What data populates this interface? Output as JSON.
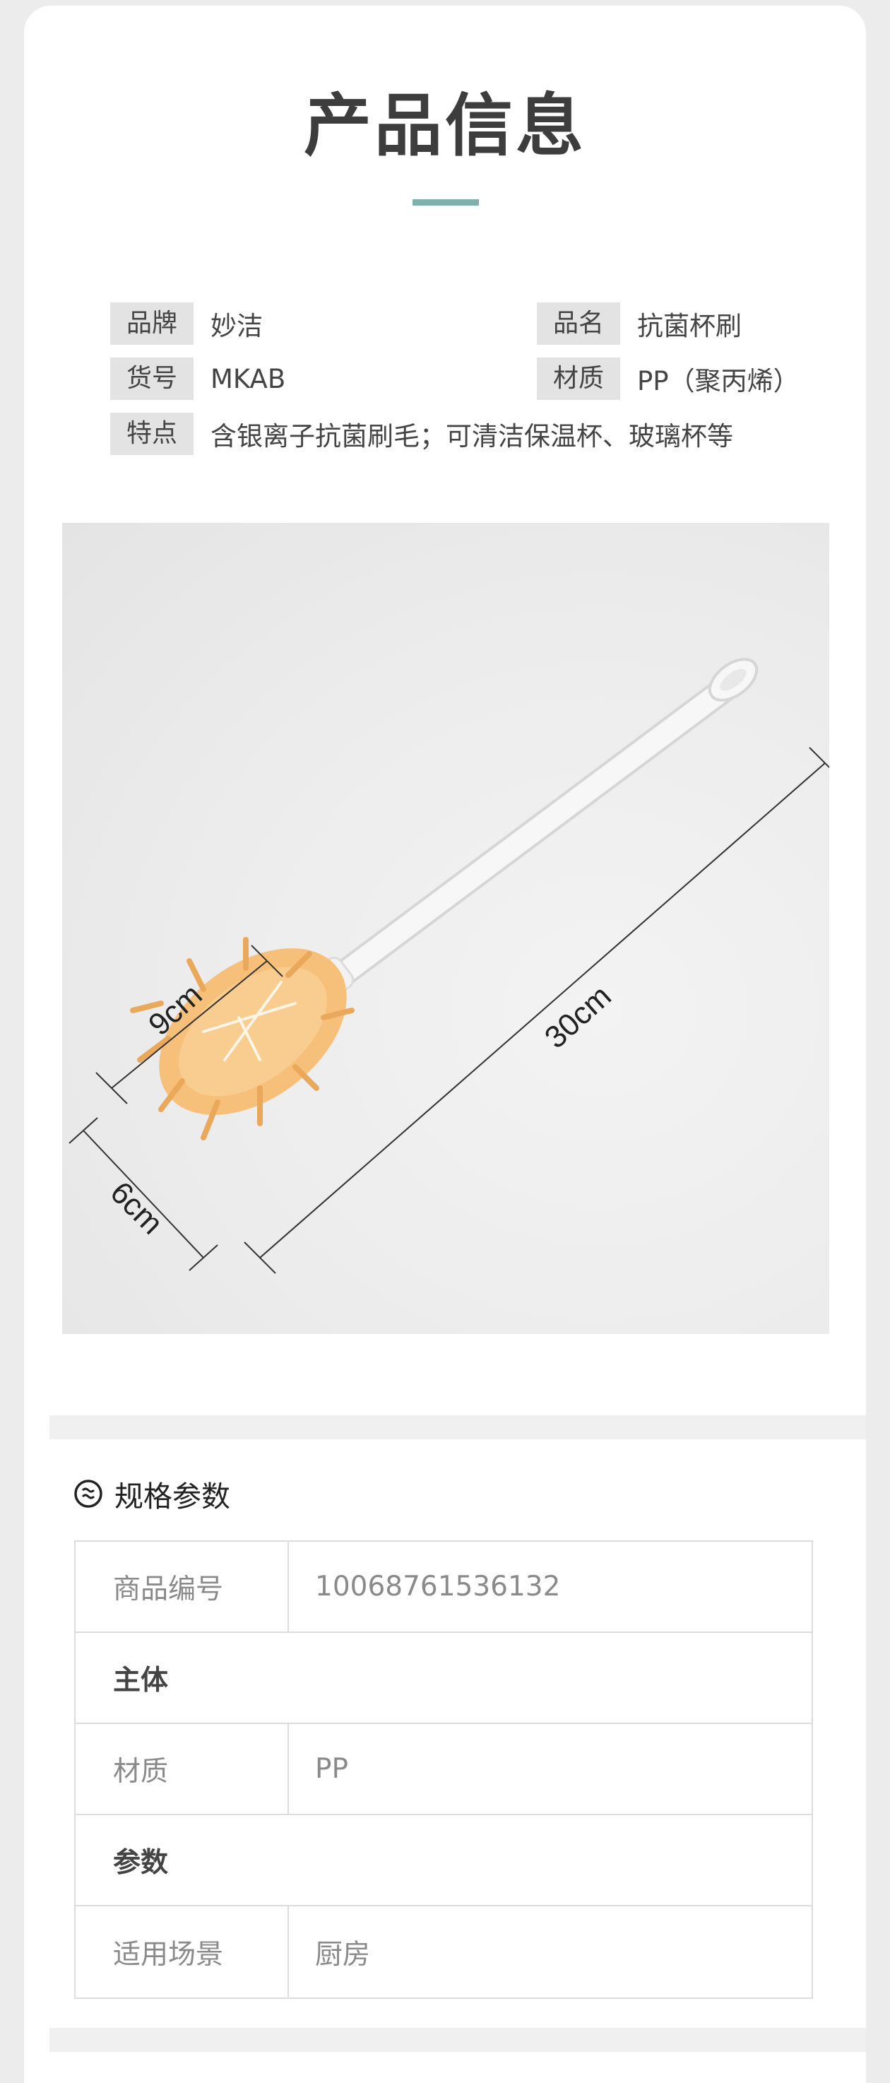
{
  "product_info": {
    "title": "产品信息",
    "fields": [
      {
        "label": "品牌",
        "value": "妙洁"
      },
      {
        "label": "品名",
        "value": "抗菌杯刷"
      },
      {
        "label": "货号",
        "value": "MKAB"
      },
      {
        "label": "材质",
        "value": "PP（聚丙烯）"
      },
      {
        "label": "特点",
        "value": "含银离子抗菌刷毛；可清洁保温杯、玻璃杯等"
      }
    ]
  },
  "photo": {
    "dimension_labels": {
      "length": "30cm",
      "head_length": "9cm",
      "head_width": "6cm"
    }
  },
  "specs": {
    "title": "规格参数",
    "rows": [
      {
        "type": "pair",
        "key": "商品编号",
        "value": "10068761536132"
      },
      {
        "type": "section",
        "label": "主体"
      },
      {
        "type": "pair",
        "key": "材质",
        "value": "PP"
      },
      {
        "type": "section",
        "label": "参数"
      },
      {
        "type": "pair",
        "key": "适用场景",
        "value": "厨房"
      }
    ]
  },
  "colors": {
    "accent": "#7fb0ab",
    "bristle": "#f7c07a",
    "label_bg": "#e3e3e3"
  }
}
